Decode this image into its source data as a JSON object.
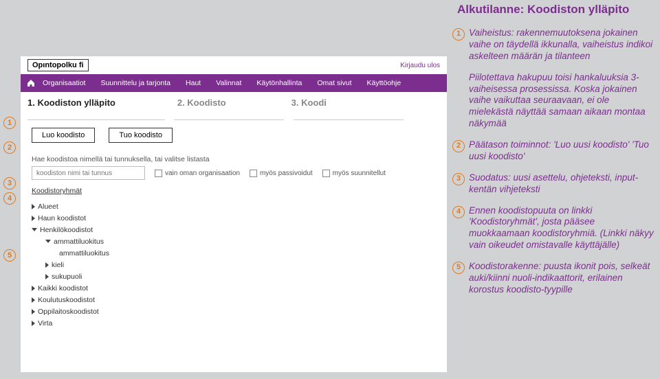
{
  "page_title": "Alkutilanne: Koodiston ylläpito",
  "annotations": {
    "a1": "Vaiheistus: rakennemuutoksena jokainen vaihe on täydellä ikkunalla, vaiheistus indikoi askelteen määrän ja tilanteen",
    "a_hidden": "Piilotettava hakupuu toisi hankaluuksia 3-vaiheisessa prosessissa. Koska jokainen vaihe vaikuttaa seuraavaan, ei ole mielekästä näyttää samaan aikaan montaa näkymää",
    "a2": "Päätason toiminnot: 'Luo uusi koodisto' 'Tuo uusi koodisto'",
    "a3": "Suodatus: uusi asettelu, ohjeteksti, input-kentän vihjeteksti",
    "a4": "Ennen koodistopuuta on linkki 'Koodistoryhmät', josta pääsee muokkaamaan koodistoryhmiä. (Linkki näkyy vain oikeudet omistavalle käyttäjälle)",
    "a5": "Koodistorakenne: puusta ikonit pois, selkeät auki/kiinni nuoli-indikaattorit, erilainen korostus koodisto-tyypille"
  },
  "topbar": {
    "logo": "Opıntopolku fi",
    "logout": "Kirjaudu ulos"
  },
  "nav": {
    "items": [
      "Organisaatiot",
      "Suunnittelu ja tarjonta",
      "Haut",
      "Valinnat",
      "Käytönhallinta",
      "Omat sivut",
      "Käyttöohje"
    ]
  },
  "crumbs": {
    "c1": "1. Koodiston ylläpito",
    "c2": "2. Koodisto",
    "c3": "3. Koodi"
  },
  "actions": {
    "create": "Luo koodisto",
    "import": "Tuo koodisto"
  },
  "search": {
    "label": "Hae koodistoa nimellä tai tunnuksella, tai valitse listasta",
    "placeholder": "koodiston nimi tai tunnus",
    "f1": "vain oman organisaation",
    "f2": "myös passivoidut",
    "f3": "myös suunnitellut"
  },
  "groups_link": "Koodistoryhmät",
  "tree": {
    "t0": "Alueet",
    "t1": "Haun koodistot",
    "t2": "Henkilökoodistot",
    "t3": "ammattiluokitus",
    "t4": "ammattiluokitus",
    "t5": "kieli",
    "t6": "sukupuoli",
    "t7": "Kaikki koodistot",
    "t8": "Koulutuskoodistot",
    "t9": "Oppilaitoskoodistot",
    "t10": "Virta"
  },
  "markers": {
    "m1": "1",
    "m2": "2",
    "m3": "3",
    "m4": "4",
    "m5": "5"
  }
}
